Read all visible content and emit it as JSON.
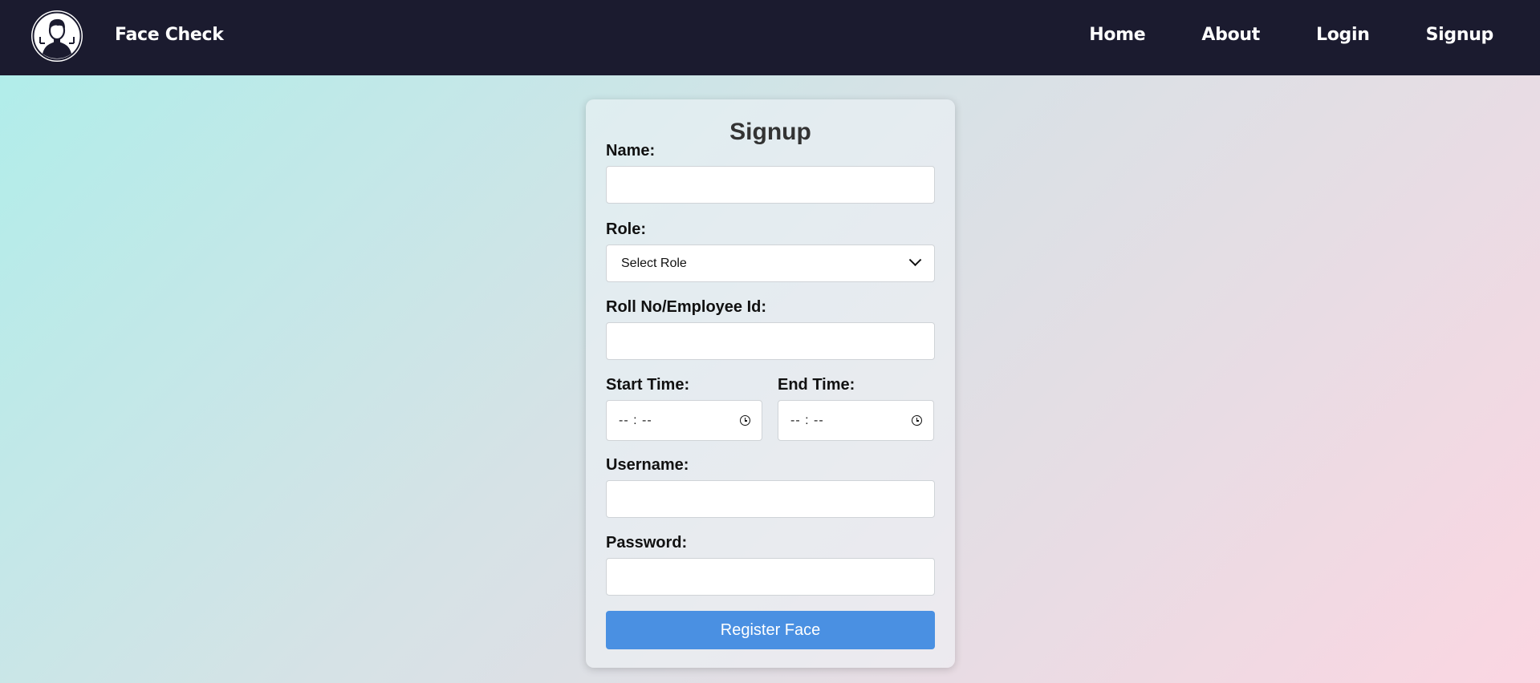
{
  "navbar": {
    "brand": "Face Check",
    "logo_icon": "face-scan-icon",
    "links": [
      "Home",
      "About",
      "Login",
      "Signup"
    ]
  },
  "form": {
    "title": "Signup",
    "name_label": "Name:",
    "name_value": "",
    "role_label": "Role:",
    "role_selected": "Select Role",
    "roll_label": "Roll No/Employee Id:",
    "roll_value": "",
    "start_time_label": "Start Time:",
    "start_time_placeholder": "-- : --",
    "end_time_label": "End Time:",
    "end_time_placeholder": "-- : --",
    "username_label": "Username:",
    "username_value": "",
    "password_label": "Password:",
    "password_value": "",
    "submit_label": "Register Face"
  },
  "colors": {
    "navbar_bg": "#1b1b2f",
    "button_bg": "#4a90e2",
    "gradient_start": "#aeeeea",
    "gradient_end": "#fbd6e2"
  }
}
